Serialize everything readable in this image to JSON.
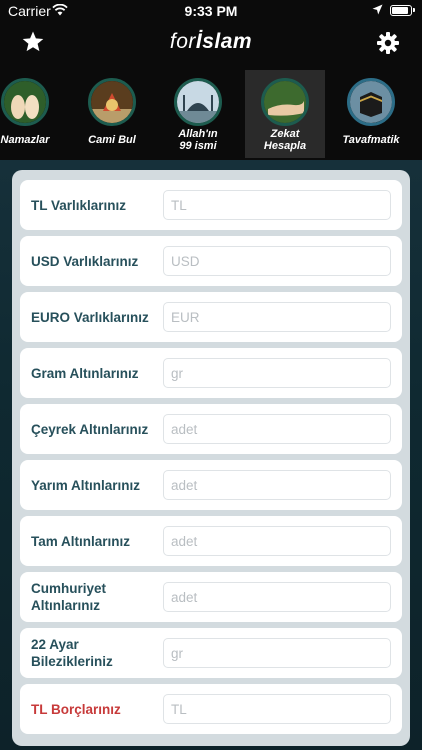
{
  "status_bar": {
    "carrier": "Carrier",
    "time": "9:33 PM"
  },
  "nav": {
    "logo_prefix": "for",
    "logo_main": "İslam"
  },
  "tabs": [
    {
      "label": "Namazlar"
    },
    {
      "label": "Cami Bul"
    },
    {
      "label_line1": "Allah'ın",
      "label_line2": "99 ismi"
    },
    {
      "label_line1": "Zekat",
      "label_line2": "Hesapla",
      "active": true
    },
    {
      "label": "Tavafmatik"
    }
  ],
  "form": {
    "rows": [
      {
        "label": "TL Varlıklarınız",
        "placeholder": "TL"
      },
      {
        "label": "USD Varlıklarınız",
        "placeholder": "USD"
      },
      {
        "label": "EURO Varlıklarınız",
        "placeholder": "EUR"
      },
      {
        "label": "Gram Altınlarınız",
        "placeholder": "gr"
      },
      {
        "label": "Çeyrek Altınlarınız",
        "placeholder": "adet"
      },
      {
        "label": "Yarım Altınlarınız",
        "placeholder": "adet"
      },
      {
        "label": "Tam Altınlarınız",
        "placeholder": "adet"
      },
      {
        "label_line1": "Cumhuriyet",
        "label_line2": "Altınlarınız",
        "placeholder": "adet"
      },
      {
        "label_line1": "22 Ayar",
        "label_line2": "Bilezikleriniz",
        "placeholder": "gr"
      },
      {
        "label": "TL Borçlarınız",
        "placeholder": "TL"
      }
    ]
  },
  "colors": {
    "label": "#27505b",
    "debt_label": "#c73a3a",
    "active_tab": "#2a2a2a"
  }
}
